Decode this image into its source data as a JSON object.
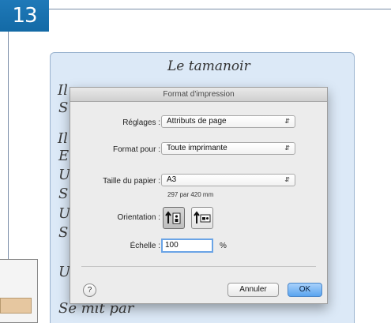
{
  "step_badge": "13",
  "document": {
    "title": "Le tamanoir",
    "lines": [
      "Il",
      "S",
      "Il",
      "E",
      "U",
      "S",
      "U",
      "S",
      "U",
      "Se mit par"
    ]
  },
  "dialog": {
    "title": "Format d'impression",
    "settings": {
      "label": "Réglages :",
      "value": "Attributs de page"
    },
    "format_for": {
      "label": "Format pour :",
      "value": "Toute imprimante"
    },
    "paper_size": {
      "label": "Taille du papier :",
      "value": "A3",
      "note": "297 par 420 mm"
    },
    "orientation": {
      "label": "Orientation :",
      "selected": "portrait"
    },
    "scale": {
      "label": "Échelle :",
      "value": "100",
      "unit": "%"
    },
    "help_label": "?",
    "cancel_label": "Annuler",
    "ok_label": "OK"
  },
  "icons": {
    "popup_arrows": "up-down-arrows-icon",
    "portrait": "portrait-orientation-icon",
    "landscape": "landscape-orientation-icon"
  },
  "colors": {
    "badge": "#1a72b0",
    "doc_window": "#dce9f7",
    "ok_button": "#5aa4ef"
  }
}
